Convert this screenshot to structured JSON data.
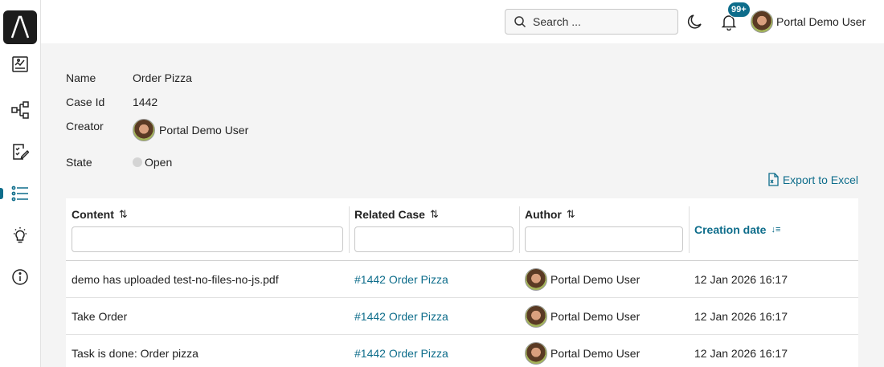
{
  "topbar": {
    "search_placeholder": "Search ...",
    "notification_count": "99+",
    "user_name": "Portal Demo User"
  },
  "sidebar": {
    "items": [
      {
        "icon": "dashboard-icon"
      },
      {
        "icon": "process-icon"
      },
      {
        "icon": "task-icon"
      },
      {
        "icon": "case-list-icon",
        "active": true
      },
      {
        "icon": "idea-icon"
      },
      {
        "icon": "info-icon"
      }
    ]
  },
  "details": {
    "name_label": "Name",
    "name_value": "Order Pizza",
    "caseid_label": "Case Id",
    "caseid_value": "1442",
    "creator_label": "Creator",
    "creator_value": "Portal Demo User",
    "state_label": "State",
    "state_value": "Open"
  },
  "export_label": "Export to Excel",
  "table": {
    "headers": {
      "content": "Content",
      "related_case": "Related Case",
      "author": "Author",
      "creation_date": "Creation date"
    },
    "rows": [
      {
        "content": "demo has uploaded test-no-files-no-js.pdf",
        "related_case": "#1442 Order Pizza",
        "author": "Portal Demo User",
        "date": "12 Jan 2026 16:17"
      },
      {
        "content": "Take Order",
        "related_case": "#1442 Order Pizza",
        "author": "Portal Demo User",
        "date": "12 Jan 2026 16:17"
      },
      {
        "content": "Task is done: Order pizza",
        "related_case": "#1442 Order Pizza",
        "author": "Portal Demo User",
        "date": "12 Jan 2026 16:17"
      }
    ]
  },
  "colors": {
    "accent": "#0e6d8b",
    "background": "#f4f4f4"
  }
}
